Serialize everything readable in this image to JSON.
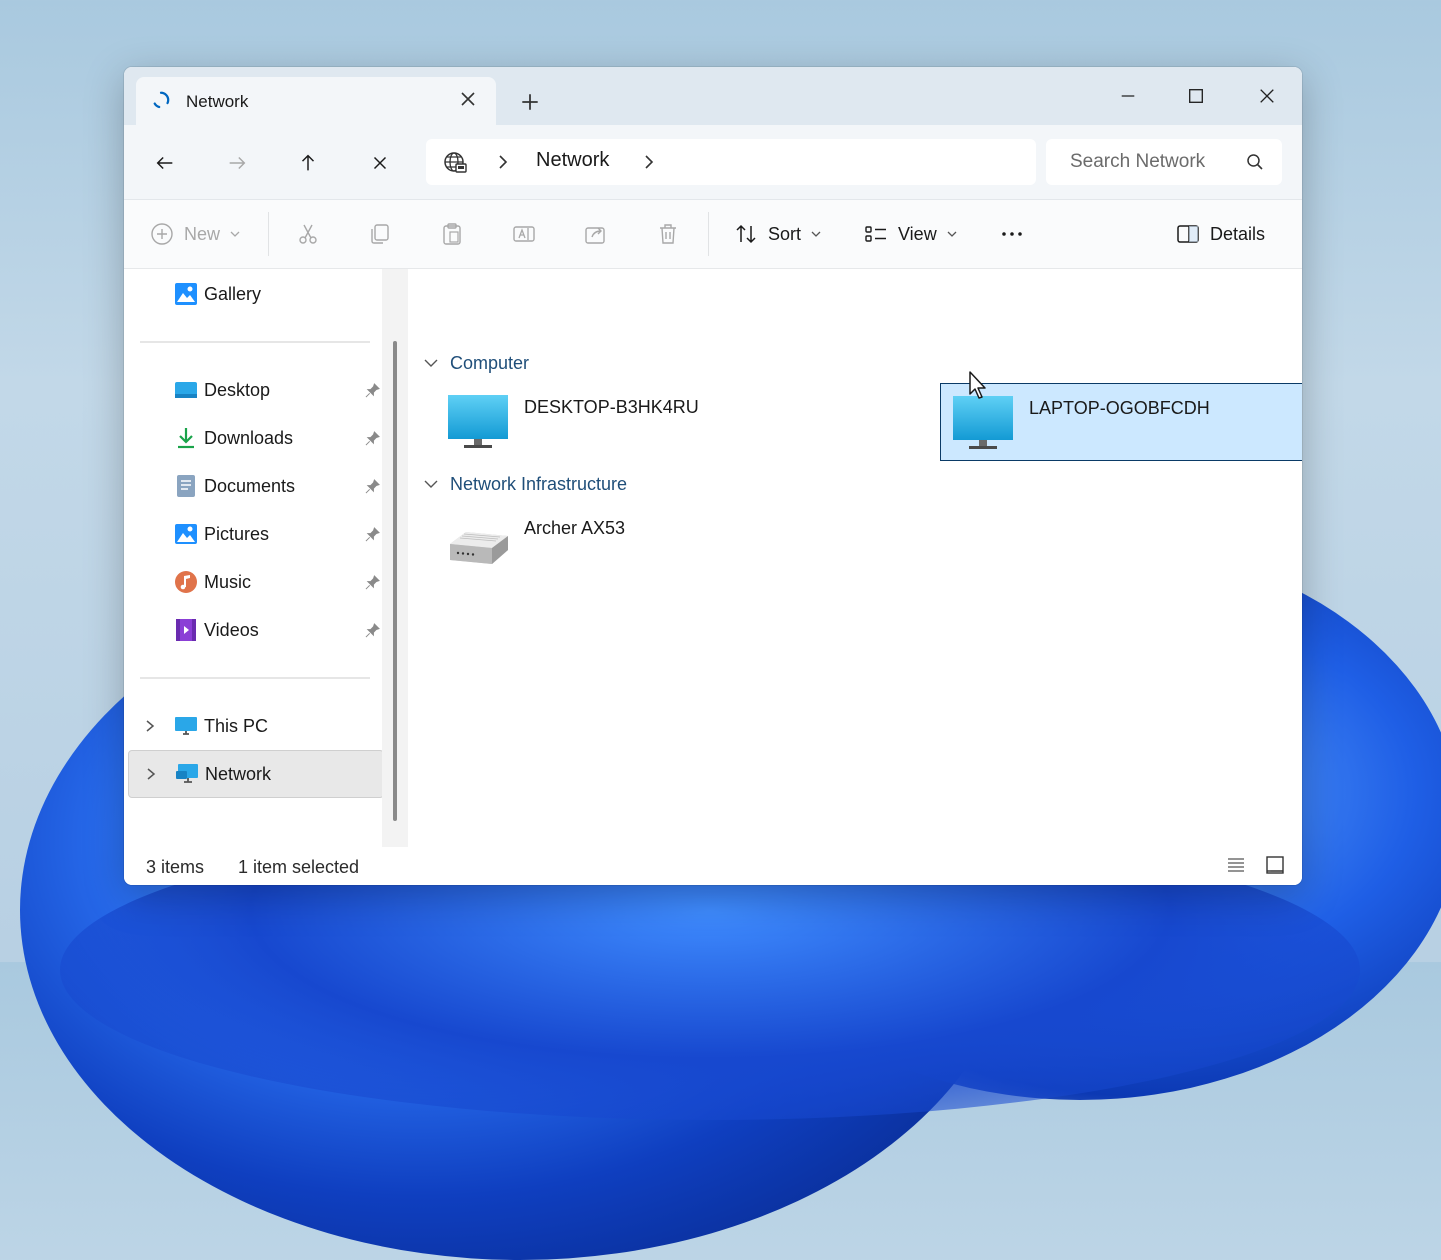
{
  "window": {
    "tab_title": "Network",
    "tab_icon": "loading-spinner-icon"
  },
  "address": {
    "breadcrumb_root_icon": "network-globe-icon",
    "breadcrumb": [
      "Network"
    ],
    "search_placeholder": "Search Network"
  },
  "toolbar": {
    "new_label": "New",
    "sort_label": "Sort",
    "view_label": "View",
    "details_label": "Details",
    "disabled_icons": [
      "cut-icon",
      "copy-icon",
      "paste-icon",
      "rename-icon",
      "share-icon",
      "delete-icon"
    ]
  },
  "sidebar": {
    "gallery": "Gallery",
    "quick_access": [
      {
        "label": "Desktop",
        "icon": "desktop-folder-icon",
        "pinned": true
      },
      {
        "label": "Downloads",
        "icon": "downloads-icon",
        "pinned": true
      },
      {
        "label": "Documents",
        "icon": "documents-icon",
        "pinned": true
      },
      {
        "label": "Pictures",
        "icon": "pictures-icon",
        "pinned": true
      },
      {
        "label": "Music",
        "icon": "music-icon",
        "pinned": true
      },
      {
        "label": "Videos",
        "icon": "videos-icon",
        "pinned": true
      }
    ],
    "this_pc": "This PC",
    "network": "Network",
    "selected": "Network"
  },
  "content": {
    "groups": [
      {
        "name": "Computer",
        "items": [
          {
            "name": "DESKTOP-B3HK4RU",
            "icon": "computer-monitor-icon",
            "selected": false
          },
          {
            "name": "LAPTOP-OGOBFCDH",
            "icon": "computer-monitor-icon",
            "selected": true
          }
        ]
      },
      {
        "name": "Network Infrastructure",
        "items": [
          {
            "name": "Archer AX53",
            "icon": "router-icon",
            "selected": false
          }
        ]
      }
    ]
  },
  "status": {
    "item_count": "3 items",
    "selection": "1 item selected"
  },
  "colors": {
    "accent": "#0067c0",
    "selection_bg": "#cce8ff",
    "group_header": "#1f4e79"
  }
}
